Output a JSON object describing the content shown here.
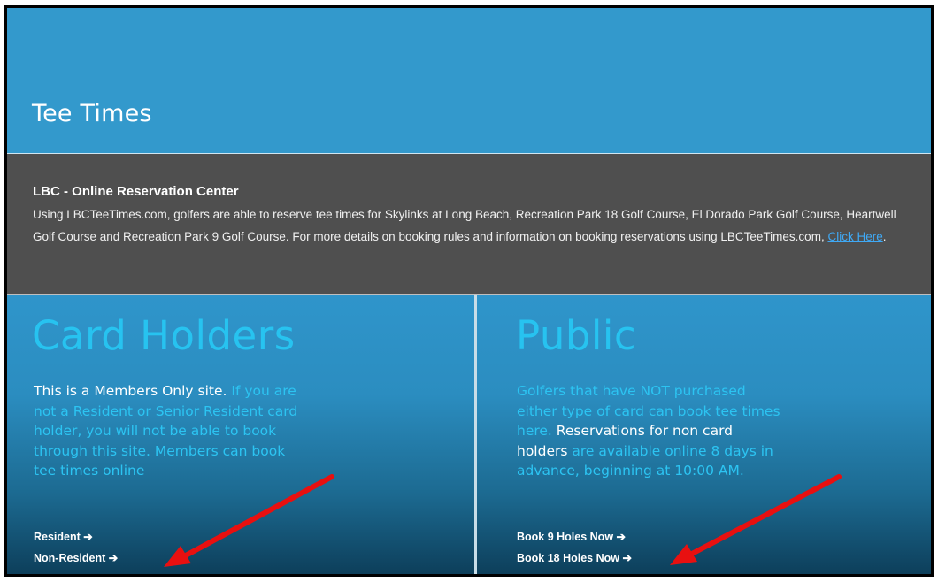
{
  "header": {
    "title": "Tee Times"
  },
  "info": {
    "heading": "LBC - Online Reservation Center",
    "body": "Using LBCTeeTimes.com, golfers are able to reserve tee times for Skylinks at Long Beach, Recreation Park 18 Golf Course, El Dorado Park Golf Course, Heartwell Golf Course and Recreation Park 9 Golf Course. For more details on booking rules and information on booking reservations using LBCTeeTimes.com, ",
    "link_label": "Click Here",
    "trailing": "."
  },
  "card_holders": {
    "title": "Card Holders",
    "desc_white": "This is a Members Only site.",
    "desc_blue": " If you are not a Resident or Senior Resident card holder, you will not be able to book through this site. Members can book tee times online",
    "links": [
      "Resident ➔",
      "Non-Resident ➔"
    ]
  },
  "public": {
    "title": "Public",
    "desc_blue_1": "Golfers that have NOT purchased either type of card can book tee times here. ",
    "desc_white_1": "Reservations for non card holders",
    "desc_blue_2": " are available online 8 days in advance, beginning at 10:00 AM.",
    "links": [
      "Book 9 Holes Now ➔",
      "Book 18 Holes Now ➔"
    ]
  },
  "colors": {
    "header_bg": "#3399cc",
    "info_bg": "#4f4f4f",
    "title_cyan": "#27c3f0",
    "link_blue": "#3fa9f5",
    "annotation_red": "#e81010"
  }
}
